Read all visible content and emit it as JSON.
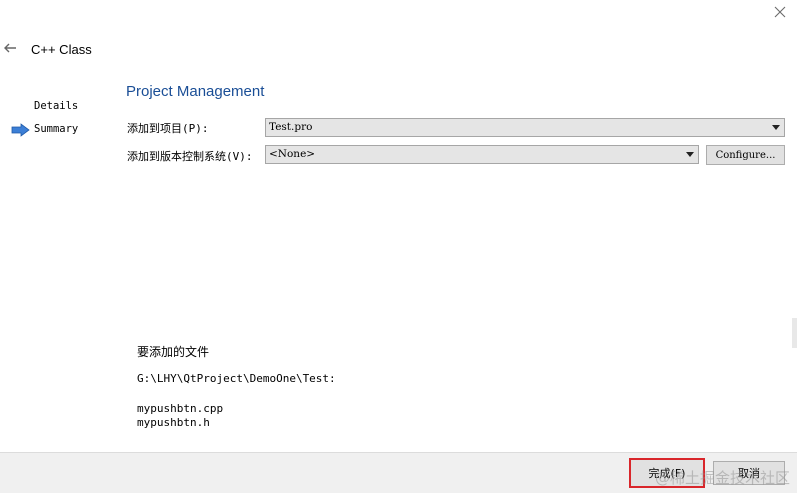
{
  "window": {
    "title": "C++ Class"
  },
  "wizard": {
    "steps": [
      {
        "label": "Details",
        "current": false
      },
      {
        "label": "Summary",
        "current": true
      }
    ]
  },
  "section": {
    "title": "Project Management"
  },
  "form": {
    "project_label": "添加到项目(P):",
    "project_value": "Test.pro",
    "vcs_label": "添加到版本控制系统(V):",
    "vcs_value": "<None>",
    "configure_label": "Configure..."
  },
  "files": {
    "title": "要添加的文件",
    "path": "G:\\LHY\\QtProject\\DemoOne\\Test:",
    "items": [
      "mypushbtn.cpp",
      "mypushbtn.h"
    ]
  },
  "footer": {
    "finish_label": "完成(F)",
    "cancel_label": "取消",
    "watermark": "@稀土掘金技术社区"
  },
  "colors": {
    "section_title": "#1a4e96",
    "highlight_border": "#d9262b",
    "step_arrow": "#3c7fd6"
  },
  "icons": {
    "close": "close-icon",
    "back": "back-arrow-icon",
    "current_step": "current-step-arrow-icon",
    "dropdown": "dropdown-arrow-icon"
  }
}
